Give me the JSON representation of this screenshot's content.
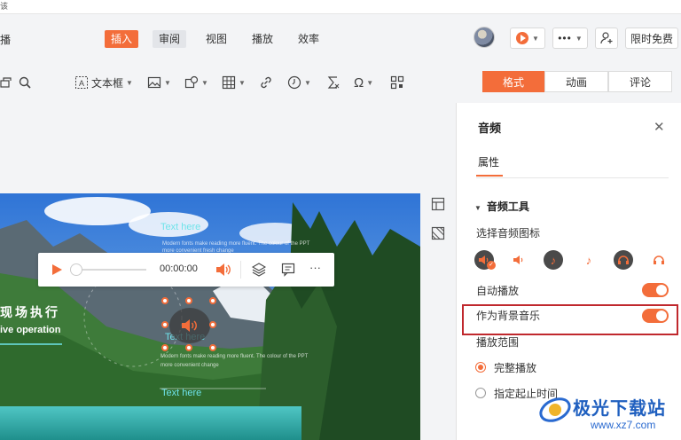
{
  "top_fragment": "该",
  "ribbon": {
    "left_fragment": "播",
    "tabs": [
      {
        "label": "插入",
        "active": true
      },
      {
        "label": "审阅",
        "active": false
      },
      {
        "label": "视图",
        "active": false
      },
      {
        "label": "播放",
        "active": false
      },
      {
        "label": "效率",
        "active": false
      }
    ],
    "limited_free": "限时免费"
  },
  "toolbar": {
    "textbox_label": "文本框"
  },
  "panel_tabs": [
    {
      "label": "格式",
      "active": true
    },
    {
      "label": "动画",
      "active": false
    },
    {
      "label": "评论",
      "active": false
    }
  ],
  "player": {
    "time": "00:00:00"
  },
  "slide": {
    "title": "现场执行",
    "subtitle": "ive operation",
    "text_here_1": "Text here",
    "text_here_2": "Text here",
    "text_here_3": "Text here",
    "tiny_1": "Modern fonts make reading more fluent. The colour of the PPT",
    "tiny_2": "more convenient fresh change",
    "tiny_3": "Modern fonts make reading more fluent. The colour of the PPT",
    "tiny_4": "more convenient change"
  },
  "panel": {
    "title": "音频",
    "props_tab": "属性",
    "section": "音频工具",
    "choose_icon": "选择音频图标",
    "autoplay": "自动播放",
    "bg_music": "作为背景音乐",
    "range": "播放范围",
    "full_play": "完整播放",
    "custom_time": "指定起止时间",
    "autoplay_on": true,
    "bg_music_on": true,
    "selected_range": "完整播放"
  },
  "watermark": {
    "text": "极光下载站",
    "url": "www.xz7.com"
  },
  "colors": {
    "accent": "#f36d3a",
    "highlight_box": "#c0282d",
    "text_here": "#6fe3ea"
  }
}
